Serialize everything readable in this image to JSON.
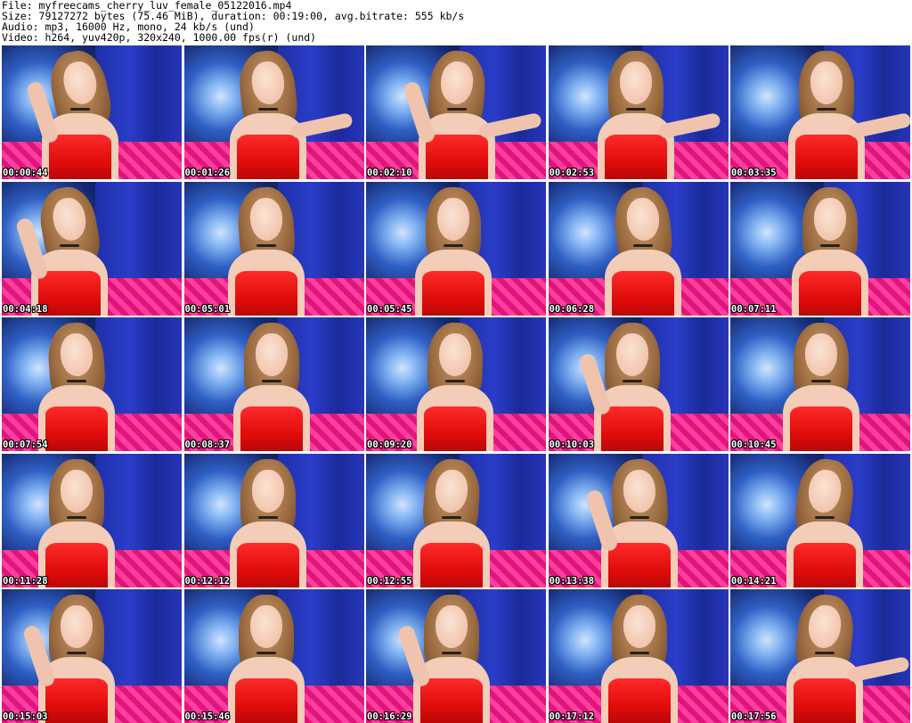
{
  "header": {
    "file": "File: myfreecams_cherry_luv_female_05122016.mp4",
    "size": "Size: 79127272 bytes (75.46 MiB), duration: 00:19:00, avg.bitrate: 555 kb/s",
    "audio": "Audio: mp3, 16000 Hz, mono, 24 kb/s (und)",
    "video": "Video: h264, yuv420p, 320x240, 1000.00 fps(r) (und)"
  },
  "frames": [
    "00:00:44",
    "00:01:26",
    "00:02:10",
    "00:02:53",
    "00:03:35",
    "00:04:18",
    "00:05:01",
    "00:05:45",
    "00:06:28",
    "00:07:11",
    "00:07:54",
    "00:08:37",
    "00:09:20",
    "00:10:03",
    "00:10:45",
    "00:11:28",
    "00:12:12",
    "00:12:55",
    "00:13:38",
    "00:14:21",
    "00:15:03",
    "00:15:46",
    "00:16:29",
    "00:17:12",
    "00:17:56"
  ],
  "colors": {
    "background_left": "#14276e",
    "background_right": "#2a3dc8",
    "floor": "#e0147a",
    "dress": "#e00c0c"
  }
}
